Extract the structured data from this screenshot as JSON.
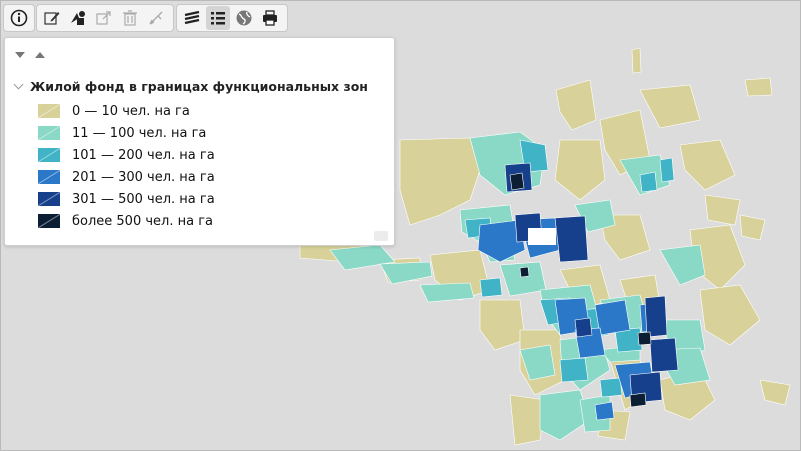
{
  "toolbar": {
    "info": {
      "icon": "info-icon"
    },
    "edit": [
      {
        "icon": "edit-icon",
        "enabled": true
      },
      {
        "icon": "shapes-icon",
        "enabled": true
      },
      {
        "icon": "external-link-icon",
        "enabled": false
      },
      {
        "icon": "trash-icon",
        "enabled": false
      },
      {
        "icon": "measure-icon",
        "enabled": false
      }
    ],
    "view": [
      {
        "icon": "layers-icon",
        "active": false
      },
      {
        "icon": "legend-list-icon",
        "active": true
      },
      {
        "icon": "globe-icon",
        "active": false
      },
      {
        "icon": "print-icon",
        "active": false
      }
    ]
  },
  "legend": {
    "group_title": "Жилой фонд в границах функциональных зон",
    "items": [
      {
        "label": "0 — 10 чел. на га",
        "color": "#d8d29a"
      },
      {
        "label": "11 — 100 чел. на га",
        "color": "#8ad8c6"
      },
      {
        "label": "101 — 200 чел. на га",
        "color": "#41b3c6"
      },
      {
        "label": "201 — 300 чел. на га",
        "color": "#2b78c8"
      },
      {
        "label": "301 — 500 чел. на га",
        "color": "#163f8c"
      },
      {
        "label": "более 500 чел. на га",
        "color": "#0b1e33"
      }
    ]
  },
  "map": {
    "background": "#dcdcdc"
  }
}
